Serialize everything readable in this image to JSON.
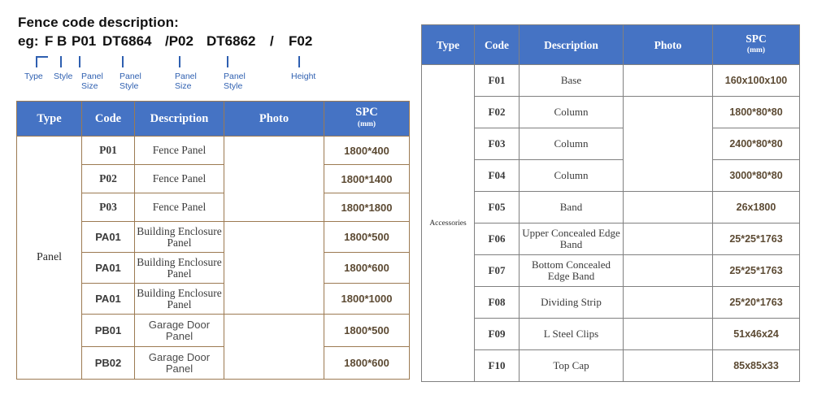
{
  "code_description": {
    "title": "Fence code description:",
    "example_prefix": "eg:",
    "tokens": [
      "F",
      "B",
      "P01",
      "DT6864",
      "/P02",
      "DT6862",
      "/",
      "F02"
    ],
    "labels": [
      "Type",
      "Style",
      "Panel\nSize",
      "Panel\nStyle",
      "Panel\nSize",
      "Panel\nStyle",
      "Height"
    ],
    "accent_color": "#2E5FB0"
  },
  "theme": {
    "header_blue": "#4573C4",
    "header_text": "#FFFFFF",
    "left_border": "#9C7A52",
    "right_border": "#808080",
    "spec_text": "#5C4A33"
  },
  "panel_table": {
    "columns": [
      "Type",
      "Code",
      "Description",
      "Photo",
      "SPC",
      "(mm)"
    ],
    "type_label": "Panel",
    "rows": [
      {
        "code": "P01",
        "description": "Fence Panel",
        "spc": "1800*400"
      },
      {
        "code": "P02",
        "description": "Fence Panel",
        "spc": "1800*1400"
      },
      {
        "code": "P03",
        "description": "Fence Panel",
        "spc": "1800*1800"
      },
      {
        "code": "PA01",
        "description": "Building Enclosure Panel",
        "spc": "1800*500"
      },
      {
        "code": "PA01",
        "description": "Building Enclosure Panel",
        "spc": "1800*600"
      },
      {
        "code": "PA01",
        "description": "Building Enclosure Panel",
        "spc": "1800*1000"
      },
      {
        "code": "PB01",
        "description": "Garage Door Panel",
        "spc": "1800*500"
      },
      {
        "code": "PB02",
        "description": "Garage Door Panel",
        "spc": "1800*600"
      }
    ],
    "photos": [
      {
        "name": "weathered-grey-wood-panel-photo",
        "rows": 3
      },
      {
        "name": "cream-enclosure-panel-photo",
        "rows": 3
      },
      {
        "name": "brown-garage-door-panel-photo",
        "rows": 2
      }
    ]
  },
  "accessories_table": {
    "columns": [
      "Type",
      "Code",
      "Description",
      "Photo",
      "SPC",
      "(mm)"
    ],
    "type_label": "Accessories",
    "rows": [
      {
        "code": "F01",
        "description": "Base",
        "spc": "160x100x100"
      },
      {
        "code": "F02",
        "description": "Column",
        "spc": "1800*80*80"
      },
      {
        "code": "F03",
        "description": "Column",
        "spc": "2400*80*80"
      },
      {
        "code": "F04",
        "description": "Column",
        "spc": "3000*80*80"
      },
      {
        "code": "F05",
        "description": "Band",
        "spc": "26x1800"
      },
      {
        "code": "F06",
        "description": "Upper Concealed Edge Band",
        "spc": "25*25*1763"
      },
      {
        "code": "F07",
        "description": "Bottom Concealed Edge Band",
        "spc": "25*25*1763"
      },
      {
        "code": "F08",
        "description": "Dividing Strip",
        "spc": "25*20*1763"
      },
      {
        "code": "F09",
        "description": "L Steel Clips",
        "spc": "51x46x24"
      },
      {
        "code": "F10",
        "description": "Top Cap",
        "spc": "85x85x33"
      }
    ],
    "photos": [
      {
        "name": "black-base-bracket-photo",
        "rows": 1
      },
      {
        "name": "black-aluminium-column-photo",
        "rows": 3
      },
      {
        "name": "black-band-strip-photo",
        "rows": 1
      },
      {
        "name": "upper-edge-band-photo",
        "rows": 1
      },
      {
        "name": "bottom-edge-band-photo",
        "rows": 1
      },
      {
        "name": "dividing-strip-photo",
        "rows": 1
      },
      {
        "name": "l-steel-clip-photo",
        "rows": 1
      },
      {
        "name": "top-cap-photo",
        "rows": 1
      }
    ]
  }
}
